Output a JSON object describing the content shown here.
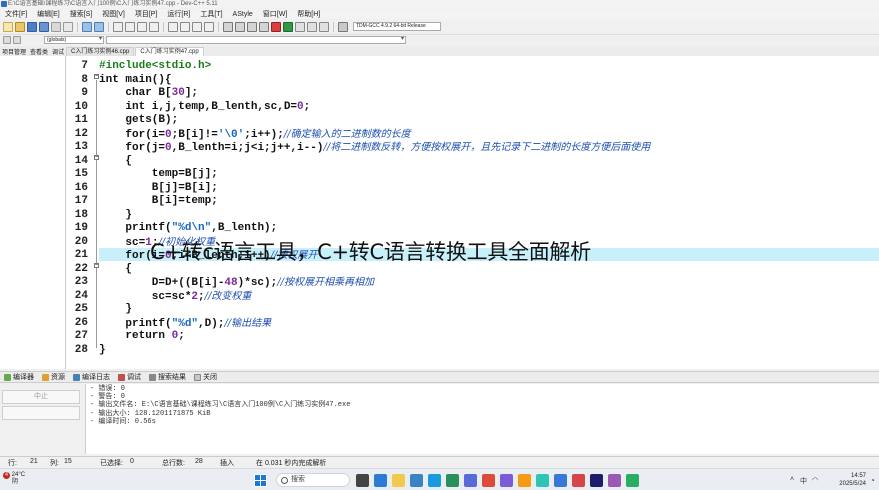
{
  "window": {
    "title": "E:\\C语言基础\\课程练习\\C语言入门100例\\C入门练习实例47.cpp - Dev-C++ 5.11"
  },
  "menu": [
    "文件[F]",
    "编辑[E]",
    "搜索[S]",
    "视图[V]",
    "项目[P]",
    "运行[R]",
    "工具[T]",
    "AStyle",
    "窗口[W]",
    "帮助[H]"
  ],
  "toolbar": {
    "compiler": "TDM-GCC 4.9.2 64-bit Release",
    "scope_combo": "(globals)"
  },
  "left_tabs": [
    "项目管理",
    "查看类",
    "调试"
  ],
  "file_tabs": [
    {
      "label": "C入门练习实例46.cpp",
      "active": false
    },
    {
      "label": "C入门练习实例47.cpp",
      "active": true
    }
  ],
  "editor": {
    "lines": [
      {
        "n": "7",
        "segs": [
          {
            "t": "#include<stdio.h>",
            "c": "pp"
          }
        ]
      },
      {
        "n": "8",
        "segs": [
          {
            "t": "int main(){",
            "c": "kw"
          }
        ]
      },
      {
        "n": "9",
        "segs": [
          {
            "t": "    char B[",
            "c": "kw"
          },
          {
            "t": "30",
            "c": "num"
          },
          {
            "t": "];",
            "c": "kw"
          }
        ]
      },
      {
        "n": "10",
        "segs": [
          {
            "t": "    int i,j,temp,B_lenth,sc,D=",
            "c": "kw"
          },
          {
            "t": "0",
            "c": "num"
          },
          {
            "t": ";",
            "c": "kw"
          }
        ]
      },
      {
        "n": "11",
        "segs": [
          {
            "t": "    gets(B);",
            "c": "kw"
          }
        ]
      },
      {
        "n": "12",
        "segs": [
          {
            "t": "    for(i=",
            "c": "kw"
          },
          {
            "t": "0",
            "c": "num"
          },
          {
            "t": ";B[i]!=",
            "c": "kw"
          },
          {
            "t": "'\\0'",
            "c": "str"
          },
          {
            "t": ";i++);",
            "c": "kw"
          },
          {
            "t": "//确定输入的二进制数的长度",
            "c": "cm"
          }
        ]
      },
      {
        "n": "13",
        "segs": [
          {
            "t": "    for(j=",
            "c": "kw"
          },
          {
            "t": "0",
            "c": "num"
          },
          {
            "t": ",B_lenth=i;j<i;j++,i--)",
            "c": "kw"
          },
          {
            "t": "//将二进制数反转，方便按权展开，且先记录下二进制的长度方便后面使用",
            "c": "cm"
          }
        ]
      },
      {
        "n": "14",
        "segs": [
          {
            "t": "    {",
            "c": "kw"
          }
        ]
      },
      {
        "n": "15",
        "segs": [
          {
            "t": "        temp=B[j];",
            "c": "kw"
          }
        ]
      },
      {
        "n": "16",
        "segs": [
          {
            "t": "        B[j]=B[i];",
            "c": "kw"
          }
        ]
      },
      {
        "n": "17",
        "segs": [
          {
            "t": "        B[i]=temp;",
            "c": "kw"
          }
        ]
      },
      {
        "n": "18",
        "segs": [
          {
            "t": "    }",
            "c": "kw"
          }
        ]
      },
      {
        "n": "19",
        "segs": [
          {
            "t": "    printf(",
            "c": "kw"
          },
          {
            "t": "\"%d\\n\"",
            "c": "str"
          },
          {
            "t": ",B_lenth);",
            "c": "kw"
          }
        ]
      },
      {
        "n": "20",
        "segs": [
          {
            "t": "    sc=",
            "c": "kw"
          },
          {
            "t": "1",
            "c": "num"
          },
          {
            "t": ";",
            "c": "kw"
          },
          {
            "t": "//初始化权重",
            "c": "cm"
          }
        ]
      },
      {
        "n": "21",
        "segs": [
          {
            "t": "    for(i=",
            "c": "kw"
          },
          {
            "t": "0",
            "c": "num"
          },
          {
            "t": ";i<B_lenth;i++)",
            "c": "kw"
          },
          {
            "t": "//按权展开",
            "c": "cm"
          }
        ]
      },
      {
        "n": "22",
        "segs": [
          {
            "t": "    {",
            "c": "kw"
          }
        ]
      },
      {
        "n": "23",
        "segs": [
          {
            "t": "        D=D+((B[i]-",
            "c": "kw"
          },
          {
            "t": "48",
            "c": "num"
          },
          {
            "t": ")*sc);",
            "c": "kw"
          },
          {
            "t": "//按权展开相乘再相加",
            "c": "cm"
          }
        ]
      },
      {
        "n": "24",
        "segs": [
          {
            "t": "        sc=sc*",
            "c": "kw"
          },
          {
            "t": "2",
            "c": "num"
          },
          {
            "t": ";",
            "c": "kw"
          },
          {
            "t": "//改变权重",
            "c": "cm"
          }
        ]
      },
      {
        "n": "25",
        "segs": [
          {
            "t": "    }",
            "c": "kw"
          }
        ]
      },
      {
        "n": "26",
        "segs": [
          {
            "t": "    printf(",
            "c": "kw"
          },
          {
            "t": "\"%d\"",
            "c": "str"
          },
          {
            "t": ",D);",
            "c": "kw"
          },
          {
            "t": "//输出结果",
            "c": "cm"
          }
        ]
      },
      {
        "n": "27",
        "segs": [
          {
            "t": "    return ",
            "c": "kw"
          },
          {
            "t": "0",
            "c": "num"
          },
          {
            "t": ";",
            "c": "kw"
          }
        ]
      },
      {
        "n": "28",
        "segs": [
          {
            "t": "}",
            "c": "kw"
          }
        ]
      }
    ]
  },
  "overlay_title": "C+转c语言工具，C+转C语言转换工具全面解析",
  "bottom_tabs": [
    "编译器",
    "资源",
    "编译日志",
    "调试",
    "搜索结果",
    "关闭"
  ],
  "bottom_panel": {
    "stop_label": "中止",
    "log": [
      "- 错误: 0",
      "- 警告: 0",
      "- 输出文件名: E:\\C语言基础\\课程练习\\C语言入门100例\\C入门练习实例47.exe",
      "- 输出大小: 128.1201171875 KiB",
      "- 编译时间: 0.56s"
    ]
  },
  "statusbar": {
    "row_label": "行:",
    "row": "21",
    "col_label": "列:",
    "col": "15",
    "sel_label": "已选择:",
    "sel": "0",
    "total_label": "总行数:",
    "total": "28",
    "mode": "插入",
    "parse": "在 0.031 秒内完成解析"
  },
  "taskbar": {
    "weather_temp": "24°C",
    "weather_desc": "阴",
    "notification_count": "4",
    "search": "搜索",
    "time": "14:57",
    "date": "2025/5/24"
  },
  "colors": {
    "highlight": "#c7f0fb",
    "comment": "#1d4fb0",
    "preprocessor": "#1a7d1a",
    "string": "#1565c0"
  }
}
